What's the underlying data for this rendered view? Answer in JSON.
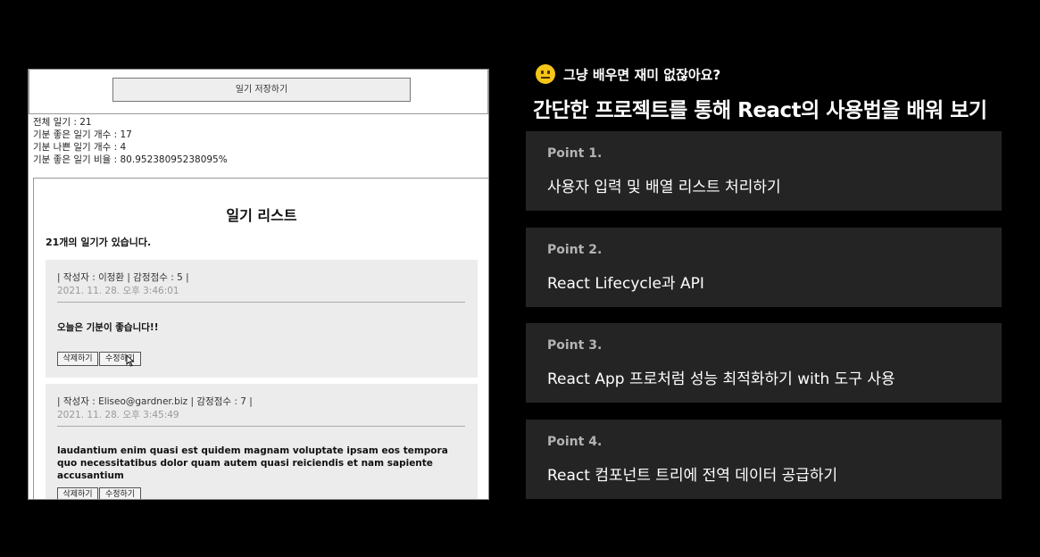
{
  "app": {
    "save_button": "일기 저장하기",
    "stats": {
      "total": "전체 일기 : 21",
      "good": "기분 좋은 일기 개수 : 17",
      "bad": "기분 나쁜 일기 개수 : 4",
      "ratio": "기분 좋은 일기 비율 : 80.95238095238095%"
    },
    "list_title": "일기 리스트",
    "list_count": "21개의 일기가 있습니다.",
    "items": [
      {
        "meta": "| 작성자 : 이정환 | 감정점수 : 5 |",
        "date": "2021. 11. 28. 오후 3:46:01",
        "content": "오늘은 기분이 좋습니다!!",
        "delete_label": "삭제하기",
        "edit_label": "수정하기"
      },
      {
        "meta": "| 작성자 : Eliseo@gardner.biz | 감정점수 : 7 |",
        "date": "2021. 11. 28. 오후 3:45:49",
        "content": "laudantium enim quasi est quidem magnam voluptate ipsam eos tempora quo necessitatibus dolor quam autem quasi reiciendis et nam sapiente accusantium",
        "delete_label": "삭제하기",
        "edit_label": "수정하기"
      }
    ]
  },
  "panel": {
    "kicker": "그냥 배우면 재미 없잖아요?",
    "kicker_icon": "neutral-face-emoji",
    "headline": "간단한 프로젝트를 통해 React의 사용법을 배워 보기",
    "points": [
      {
        "label": "Point 1.",
        "text": "사용자 입력 및 배열 리스트 처리하기"
      },
      {
        "label": "Point 2.",
        "text": "React Lifecycle과 API"
      },
      {
        "label": "Point 3.",
        "text": "React App 프로처럼 성능 최적화하기 with 도구 사용"
      },
      {
        "label": "Point 4.",
        "text": "React 컴포넌트 트리에 전역 데이터 공급하기"
      }
    ]
  },
  "colors": {
    "background": "#000000",
    "card": "#242424",
    "point_label": "#b3b3b3",
    "emoji": "#f5c518"
  }
}
